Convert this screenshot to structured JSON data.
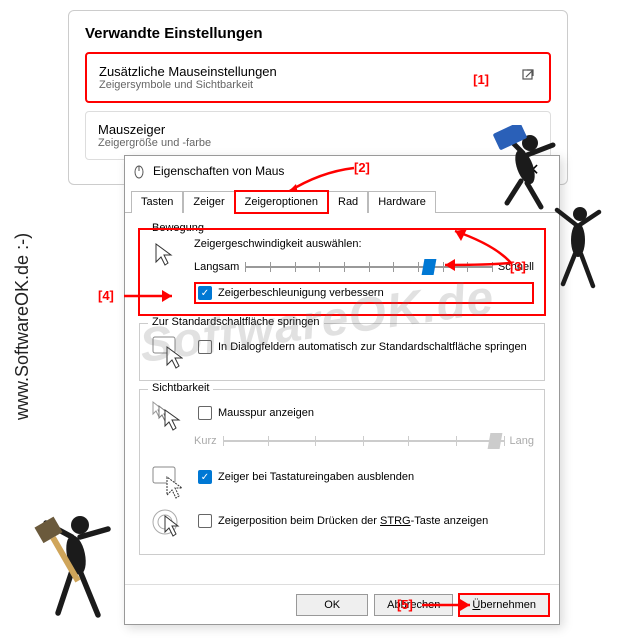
{
  "settings_panel": {
    "title": "Verwandte Einstellungen",
    "card1": {
      "title": "Zusätzliche Mauseinstellungen",
      "sub": "Zeigersymbole und Sichtbarkeit"
    },
    "card2": {
      "title": "Mauszeiger",
      "sub": "Zeigergröße und -farbe"
    }
  },
  "annotations": {
    "a1": "[1]",
    "a2": "[2]",
    "a3": "[3]",
    "a4": "[4]",
    "a5": "[5]"
  },
  "dialog": {
    "title": "Eigenschaften von Maus",
    "tabs": [
      "Tasten",
      "Zeiger",
      "Zeigeroptionen",
      "Rad",
      "Hardware"
    ],
    "bewegung": {
      "label": "Bewegung",
      "speed_label": "Zeigergeschwindigkeit auswählen:",
      "slow": "Langsam",
      "fast": "Schnell",
      "accel": "Zeigerbeschleunigung verbessern"
    },
    "snap": {
      "label": "Zur Standardschaltfläche springen",
      "text": "In Dialogfeldern automatisch zur Standardschaltfläche springen"
    },
    "sicht": {
      "label": "Sichtbarkeit",
      "trail": "Mausspur anzeigen",
      "short": "Kurz",
      "long": "Lang",
      "hide": "Zeiger bei Tastatureingaben ausblenden",
      "ctrl_pre": "Zeigerposition beim Drücken der ",
      "ctrl_key": "STRG",
      "ctrl_post": "-Taste anzeigen"
    },
    "buttons": {
      "ok": "OK",
      "cancel": "Abbrechen",
      "apply_pre": "Ü",
      "apply_rest": "bernehmen"
    }
  },
  "watermark": "SoftwareOK.de",
  "side_text": "www.SoftwareOK.de  :-)"
}
